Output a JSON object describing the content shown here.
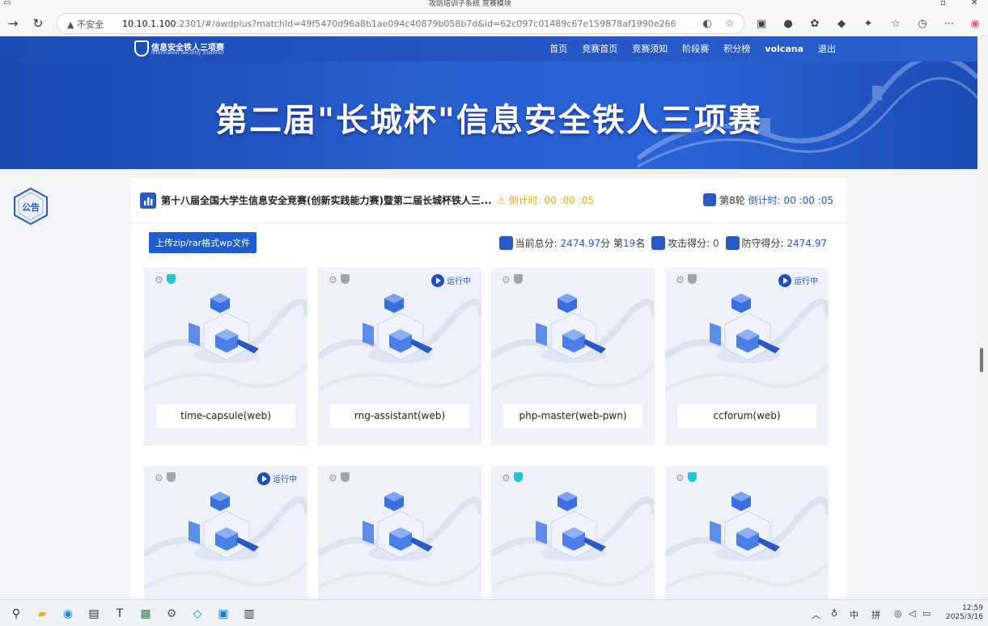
{
  "browser": {
    "tab_title": "攻防培训子系统 竞赛模块",
    "not_secure": "不安全",
    "url_host": "10.10.1.100",
    "url_rest": ":2301/#/awdplus?matchId=49f5470d96a8b1ae094c40879b058b7d&id=62c097c01489c67e159878af1990e266"
  },
  "site": {
    "logo_cn": "信息安全铁人三项赛",
    "logo_en": "Information Security Triathlon",
    "nav": [
      "首页",
      "竞赛首页",
      "竞赛须知",
      "阶段赛",
      "积分榜",
      "volcana",
      "退出"
    ],
    "banner_title": "第二届\"长城杯\"信息安全铁人三项赛",
    "notice_label": "公告"
  },
  "competition": {
    "title": "第十八届全国大学生信息安全竞赛(创新实践能力赛)暨第二届长城杯铁人三...",
    "countdown_label": "倒计时:",
    "countdown_value": "00 :00 :05",
    "round_label": "第8轮",
    "round_countdown_label": "倒计时:",
    "round_countdown_value": "00 :00 :05",
    "upload_button": "上传zip/rar格式wp文件",
    "total_score_label": "当前总分:",
    "total_score_value": "2474.97",
    "score_unit": "分",
    "rank_text_pre": "第",
    "rank_value": "19",
    "rank_text_post": "名",
    "attack_label": "攻击得分:",
    "attack_value": "0",
    "defense_label": "防守得分:",
    "defense_value": "2474.97"
  },
  "challenges": [
    {
      "name": "time-capsule(web)",
      "running": false,
      "shield_active": true
    },
    {
      "name": "rng-assistant(web)",
      "running": true,
      "shield_active": false
    },
    {
      "name": "php-master(web-pwn)",
      "running": false,
      "shield_active": false
    },
    {
      "name": "ccforum(web)",
      "running": true,
      "shield_active": false
    },
    {
      "name": "",
      "running": true,
      "shield_active": false
    },
    {
      "name": "",
      "running": false,
      "shield_active": false
    },
    {
      "name": "",
      "running": false,
      "shield_active": true
    },
    {
      "name": "",
      "running": false,
      "shield_active": true
    }
  ],
  "running_label": "运行中",
  "taskbar": {
    "ime_zh": "中",
    "ime_pinyin": "拼",
    "time": "12:59",
    "date": "2025/3/16"
  },
  "colors": {
    "brand": "#1f5ccc",
    "countdown": "#e6a817",
    "shield_on": "#26c3d6"
  }
}
